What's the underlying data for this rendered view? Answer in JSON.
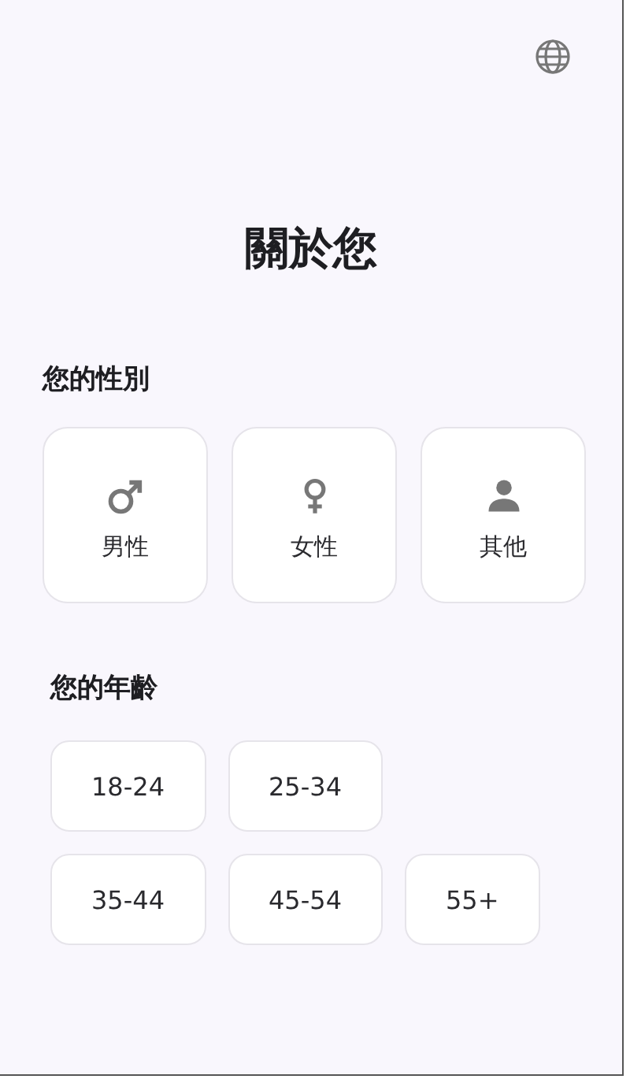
{
  "title": "關於您",
  "gender": {
    "heading": "您的性別",
    "options": [
      {
        "kind": "male",
        "label": "男性"
      },
      {
        "kind": "female",
        "label": "女性"
      },
      {
        "kind": "other",
        "label": "其他"
      }
    ]
  },
  "age": {
    "heading": "您的年齡",
    "options": [
      {
        "label": "18-24"
      },
      {
        "label": "25-34"
      },
      {
        "label": "35-44"
      },
      {
        "label": "45-54"
      },
      {
        "label": "55+"
      }
    ]
  }
}
